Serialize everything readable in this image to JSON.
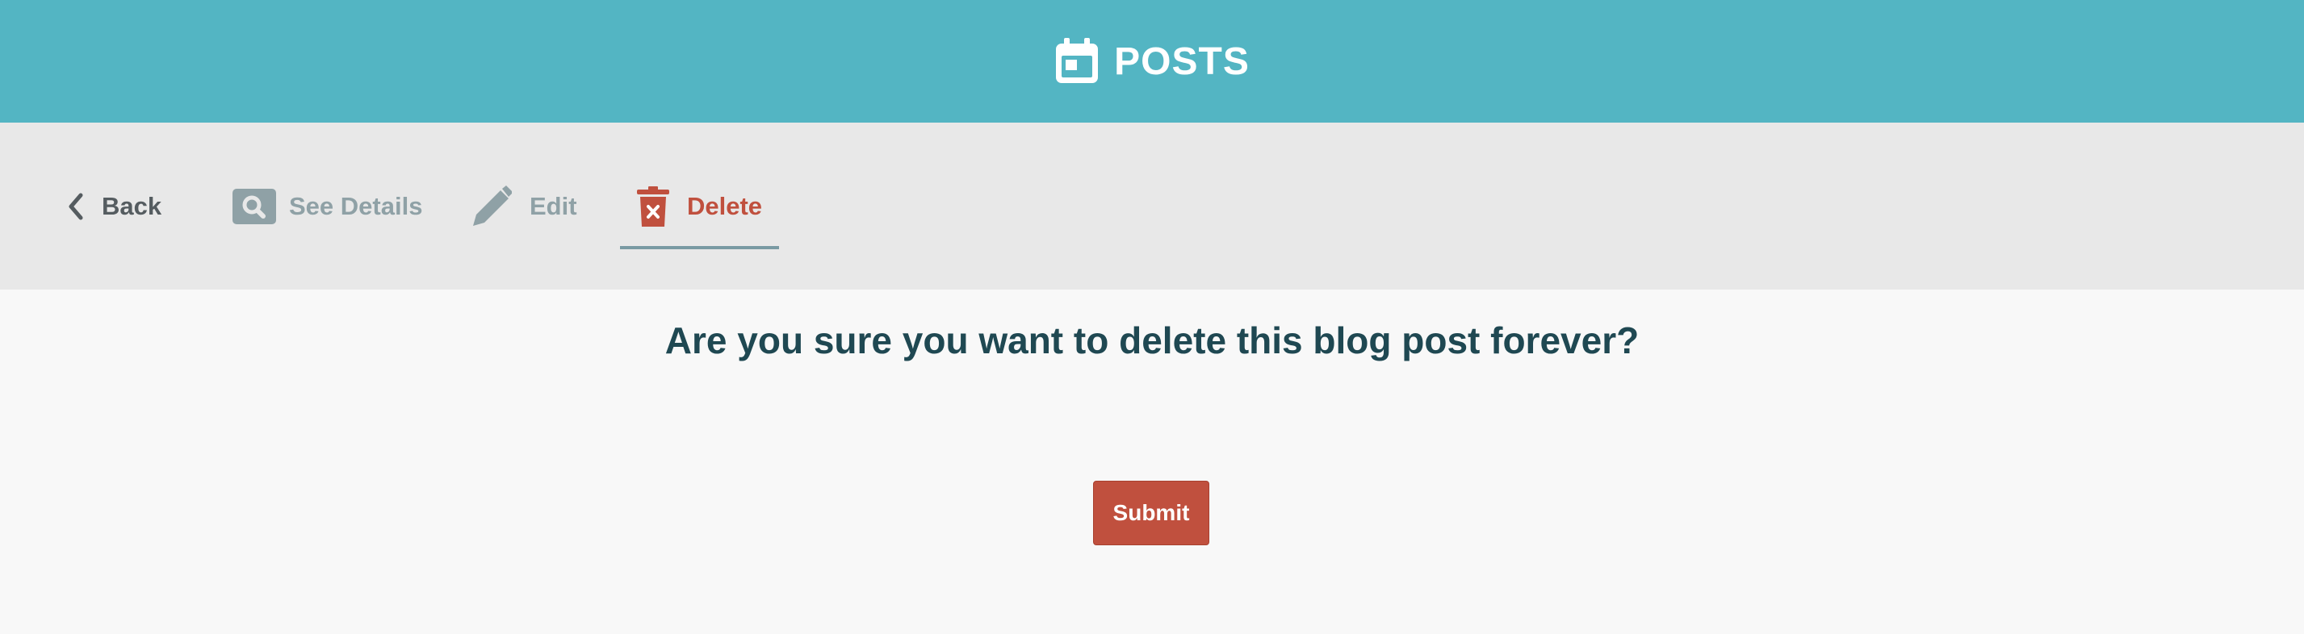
{
  "header": {
    "title": "POSTS",
    "icon": "calendar-icon"
  },
  "toolbar": {
    "tabs": [
      {
        "label": "Back",
        "icon": "chevron-left-icon",
        "color": "#555c60"
      },
      {
        "label": "See Details",
        "icon": "search-icon",
        "color": "#8fa1a6"
      },
      {
        "label": "Edit",
        "icon": "pencil-icon",
        "color": "#8fa1a6"
      },
      {
        "label": "Delete",
        "icon": "trash-icon",
        "color": "#c0503e",
        "active": true
      }
    ]
  },
  "main": {
    "question": "Are you sure you want to delete this blog post forever?",
    "submit_label": "Submit"
  },
  "colors": {
    "header_bg": "#53b5c3",
    "toolbar_bg": "#e8e8e8",
    "danger": "#c0503e",
    "heading": "#1f4852"
  }
}
